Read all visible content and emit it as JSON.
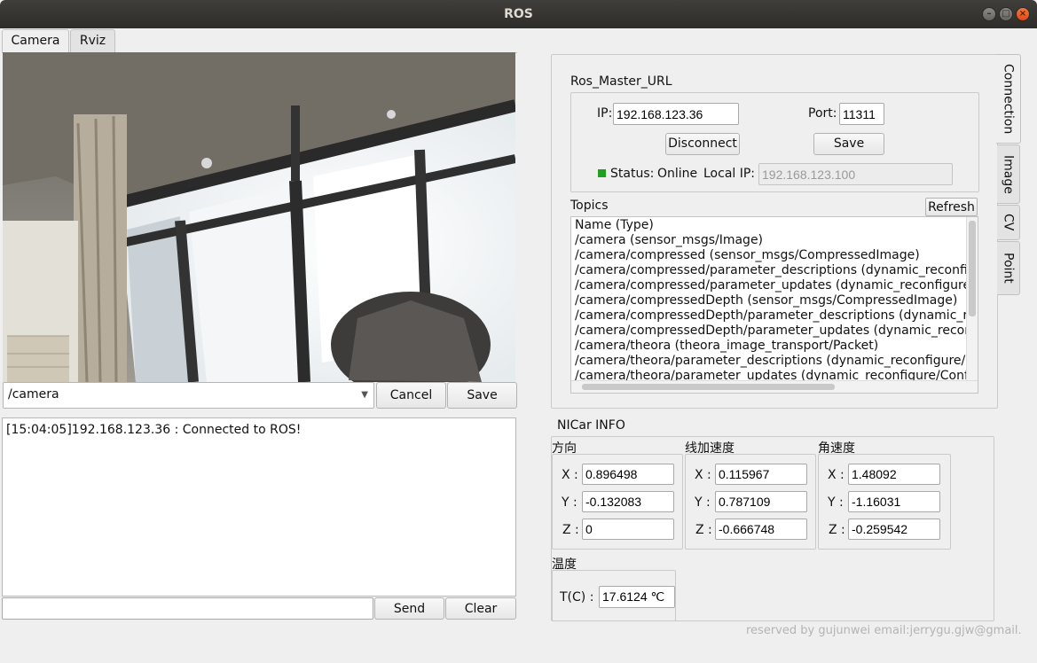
{
  "window": {
    "title": "ROS"
  },
  "main_tabs": [
    {
      "label": "Camera"
    },
    {
      "label": "Rviz"
    }
  ],
  "camera": {
    "topic_selected": "/camera",
    "cancel_label": "Cancel",
    "save_label": "Save"
  },
  "log": {
    "lines": [
      "[15:04:05]192.168.123.36 :  Connected to ROS!"
    ]
  },
  "message_input": {
    "value": ""
  },
  "message_actions": {
    "send_label": "Send",
    "clear_label": "Clear"
  },
  "side_tabs": [
    {
      "label": "Connection"
    },
    {
      "label": "Image"
    },
    {
      "label": "CV"
    },
    {
      "label": "Point"
    }
  ],
  "connection": {
    "group_title": "Ros_Master_URL",
    "ip_label": "IP:",
    "ip_value": "192.168.123.36",
    "port_label": "Port:",
    "port_value": "11311",
    "disconnect_label": "Disconnect",
    "save_label": "Save",
    "status_label": "Status:",
    "status_value": "Online",
    "status_color": "#1fa01f",
    "local_ip_label": "Local IP:",
    "local_ip_value": "192.168.123.100"
  },
  "topics": {
    "title": "Topics",
    "refresh_label": "Refresh",
    "items": [
      "Name   (Type)",
      "/camera   (sensor_msgs/Image)",
      "/camera/compressed   (sensor_msgs/CompressedImage)",
      "/camera/compressed/parameter_descriptions   (dynamic_reconfigure/ConfigDescription)",
      "/camera/compressed/parameter_updates   (dynamic_reconfigure/Config)",
      "/camera/compressedDepth   (sensor_msgs/CompressedImage)",
      "/camera/compressedDepth/parameter_descriptions   (dynamic_reconfigure/ConfigDescription)",
      "/camera/compressedDepth/parameter_updates   (dynamic_reconfigure/Config)",
      "/camera/theora   (theora_image_transport/Packet)",
      "/camera/theora/parameter_descriptions   (dynamic_reconfigure/ConfigDescription)",
      "/camera/theora/parameter_updates   (dynamic_reconfigure/Config)"
    ]
  },
  "nicar": {
    "title": "NICar INFO",
    "groups": [
      {
        "title": "方向",
        "x": "0.896498",
        "y": "-0.132083",
        "z": "0"
      },
      {
        "title": "线加速度",
        "x": "0.115967",
        "y": "0.787109",
        "z": "-0.666748"
      },
      {
        "title": "角速度",
        "x": "1.48092",
        "y": "-1.16031",
        "z": "-0.259542"
      }
    ],
    "x_label": "X :",
    "y_label": "Y :",
    "z_label": "Z :",
    "temp_title": "温度",
    "temp_label": "T(C) :",
    "temp_value": "17.6124 ℃"
  },
  "footer": {
    "text": "reserved by gujunwei email:jerrygu.gjw@gmail."
  }
}
